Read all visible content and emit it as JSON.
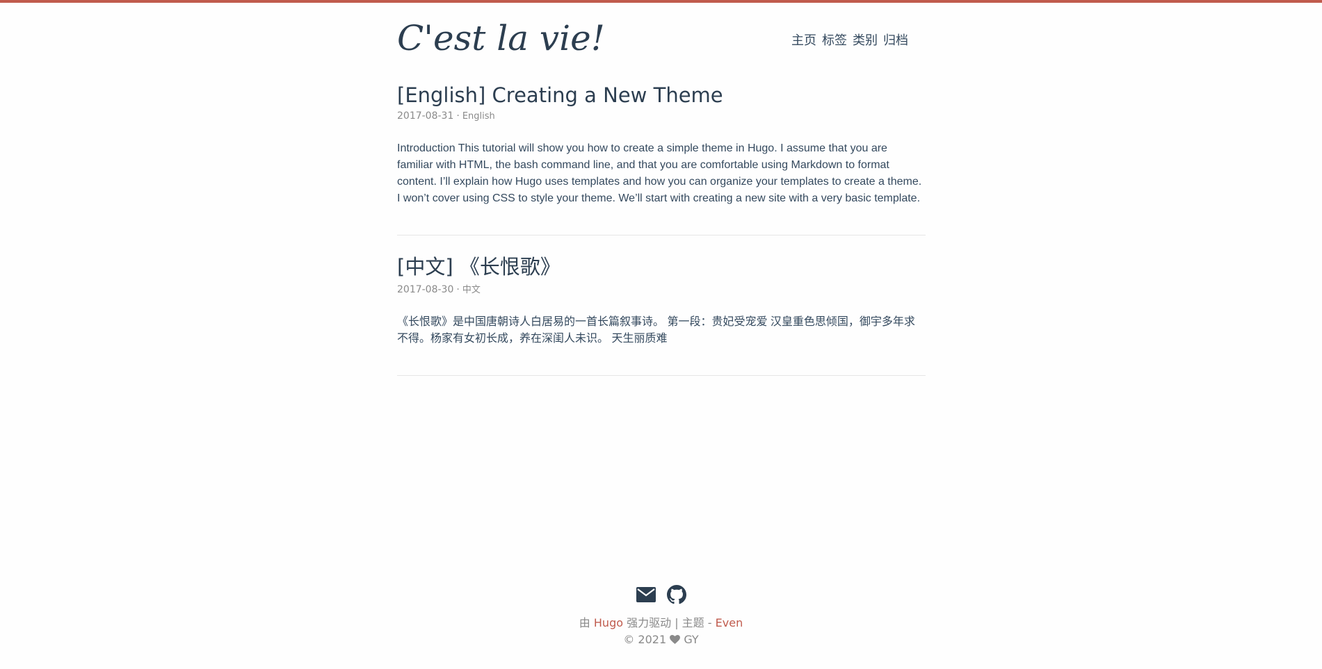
{
  "site": {
    "logo": "C'est la vie!"
  },
  "nav": {
    "items": [
      {
        "label": "主页"
      },
      {
        "label": "标签"
      },
      {
        "label": "类别"
      },
      {
        "label": "归档"
      }
    ]
  },
  "posts": [
    {
      "title": "[English] Creating a New Theme",
      "date": "2017-08-31",
      "separator": "·",
      "category": "English",
      "summary": "Introduction This tutorial will show you how to create a simple theme in Hugo. I assume that you are familiar with HTML, the bash command line, and that you are comfortable using Markdown to format content. I’ll explain how Hugo uses templates and how you can organize your templates to create a theme. I won’t cover using CSS to style your theme. We’ll start with creating a new site with a very basic template."
    },
    {
      "title": "[中文] 《长恨歌》",
      "date": "2017-08-30",
      "separator": "·",
      "category": "中文",
      "summary": "《长恨歌》是中国唐朝诗人白居易的一首长篇叙事诗。 第一段：贵妃受宠爱 汉皇重色思倾国，御宇多年求不得。杨家有女初长成，养在深闺人未识。 天生丽质难"
    }
  ],
  "footer": {
    "social": [
      {
        "icon": "email-icon"
      },
      {
        "icon": "github-icon"
      }
    ],
    "powered_prefix": "由",
    "powered_link": "Hugo",
    "powered_middle": "强力驱动 | 主题 -",
    "theme_link": "Even",
    "copyright_prefix": "© 2021",
    "copyright_author": "GY"
  },
  "colors": {
    "accent": "#c05b4d",
    "text": "#34495e",
    "meta": "#8a8a8a"
  }
}
